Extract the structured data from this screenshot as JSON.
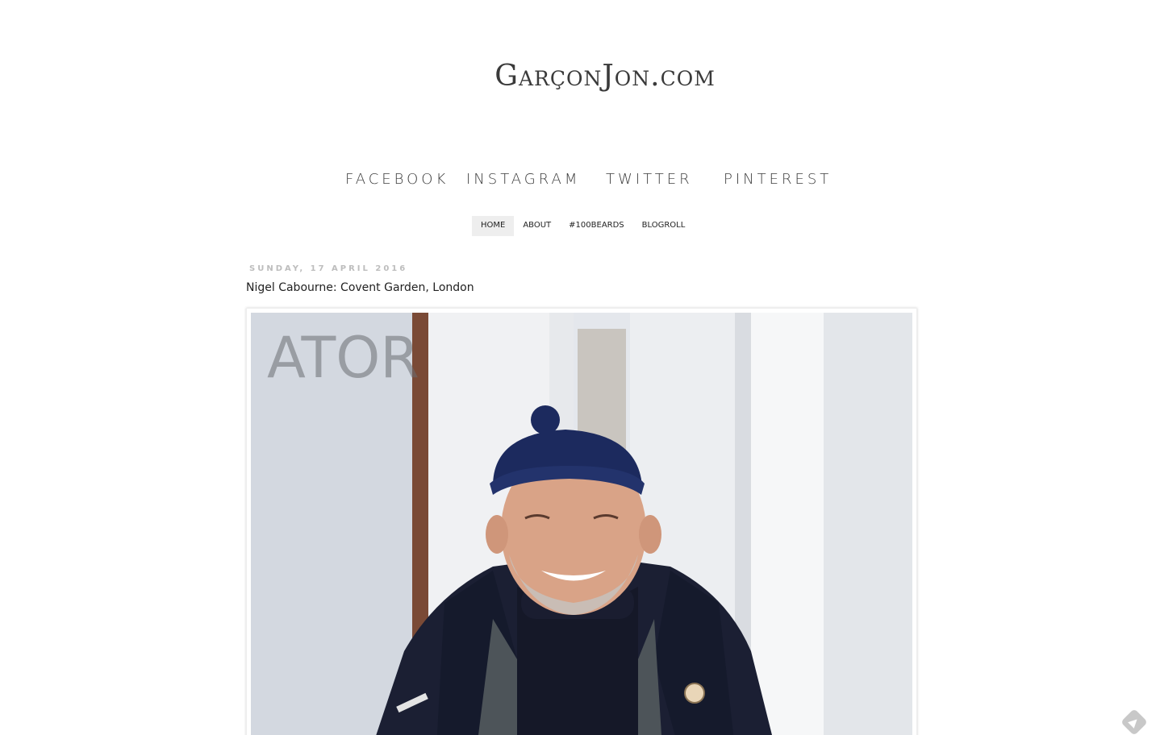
{
  "header": {
    "site_title": "GarçonJon.com"
  },
  "social_nav": {
    "items": [
      {
        "label": "FACEBOOK"
      },
      {
        "label": "INSTAGRAM"
      },
      {
        "label": "TWITTER"
      },
      {
        "label": "PINTEREST"
      }
    ]
  },
  "page_tabs": {
    "items": [
      {
        "label": "HOME",
        "active": true
      },
      {
        "label": "ABOUT",
        "active": false
      },
      {
        "label": "#100BEARDS",
        "active": false
      },
      {
        "label": "BLOGROLL",
        "active": false
      }
    ]
  },
  "post": {
    "date": "Sunday, 17 April 2016",
    "title": "Nigel Cabourne: Covent Garden, London",
    "image_alt": "Smiling man in navy beanie and navy coat"
  },
  "icons": {
    "corner_icon": "feedly-icon"
  }
}
